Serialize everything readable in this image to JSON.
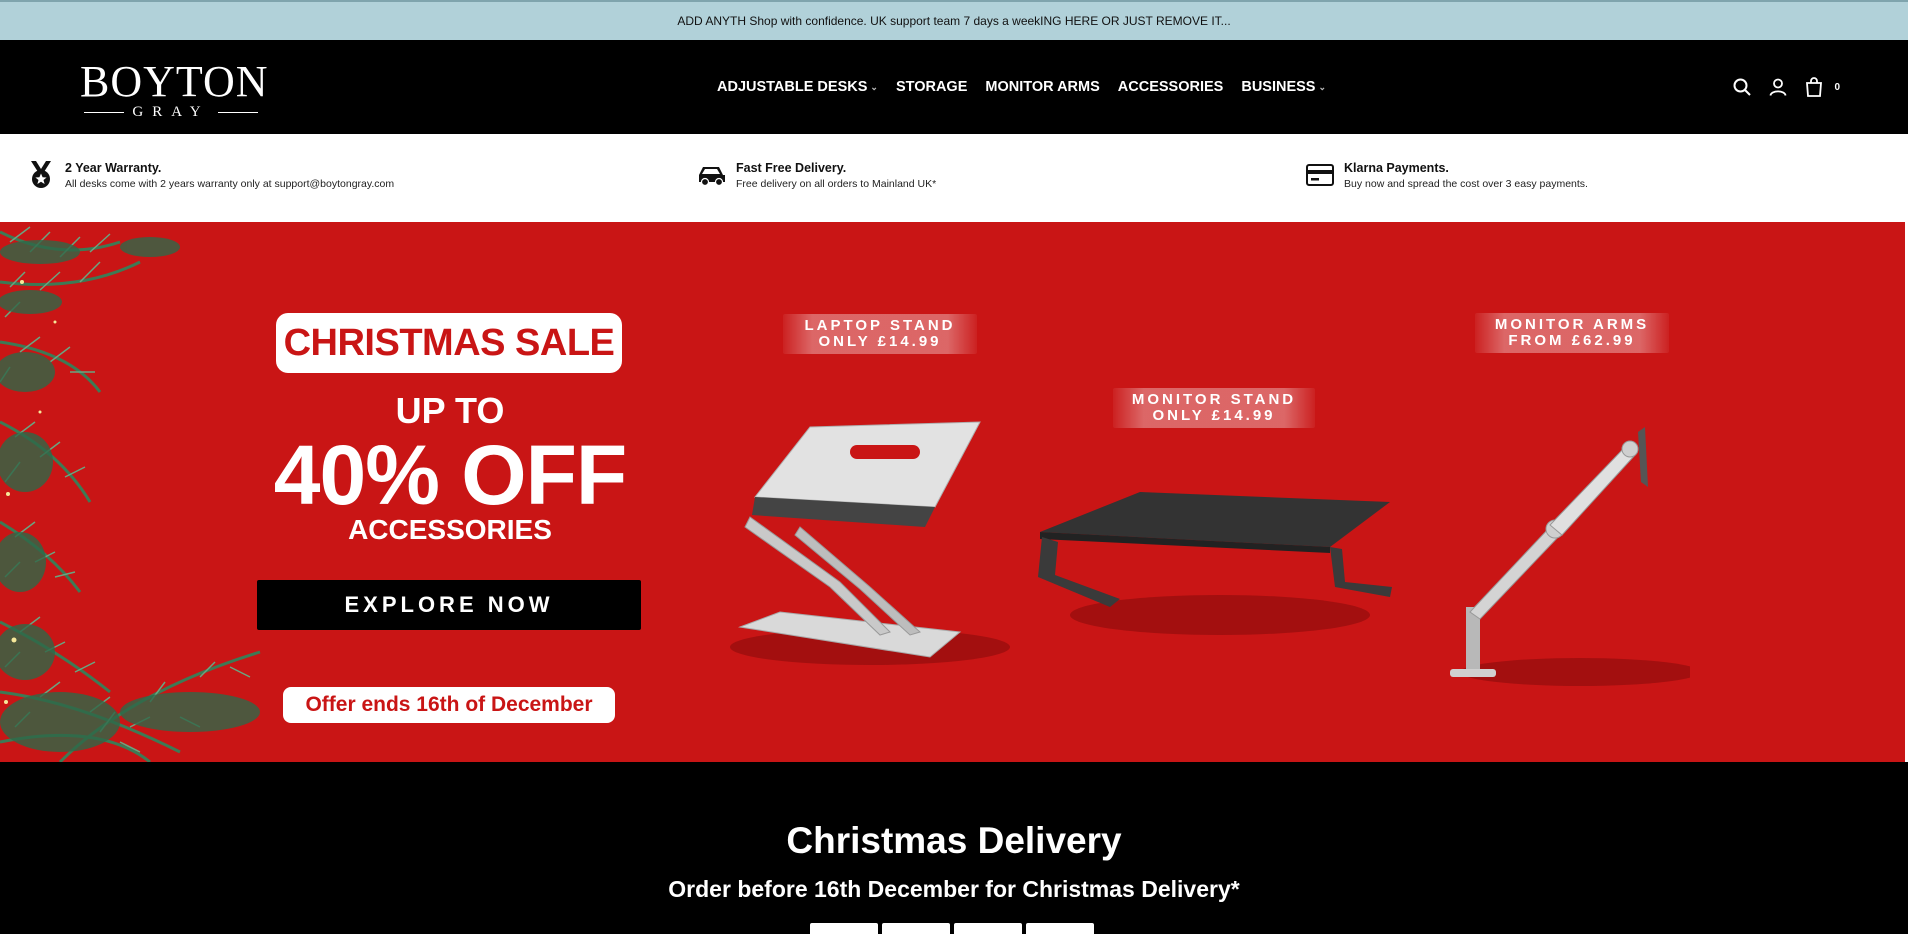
{
  "announcement": "ADD ANYTH Shop with confidence. UK support team 7 days a weekING HERE OR JUST REMOVE IT...",
  "logo": {
    "main": "BOYTON",
    "sub": "GRAY"
  },
  "nav": [
    {
      "label": "ADJUSTABLE DESKS",
      "has_dropdown": true
    },
    {
      "label": "STORAGE",
      "has_dropdown": false
    },
    {
      "label": "MONITOR ARMS",
      "has_dropdown": false
    },
    {
      "label": "ACCESSORIES",
      "has_dropdown": false
    },
    {
      "label": "BUSINESS",
      "has_dropdown": true
    }
  ],
  "header_icons": [
    "search-icon",
    "account-icon",
    "cart-icon"
  ],
  "cart_count": "0",
  "usps": [
    {
      "icon": "medal-icon",
      "title": "2 Year Warranty.",
      "desc": "All desks come with 2 years warranty only at support@boytongray.com"
    },
    {
      "icon": "car-icon",
      "title": "Fast Free Delivery.",
      "desc": "Free delivery on all orders to Mainland UK*"
    },
    {
      "icon": "credit-card-icon",
      "title": "Klarna Payments.",
      "desc": "Buy now and spread the cost over 3 easy payments."
    }
  ],
  "hero": {
    "badge": "CHRISTMAS SALE",
    "upto": "UP TO",
    "percent": "40% OFF",
    "category": "ACCESSORIES",
    "cta": "EXPLORE NOW",
    "offer": "Offer ends 16th of December",
    "tags": [
      {
        "line1": "LAPTOP STAND",
        "line2": "ONLY £14.99"
      },
      {
        "line1": "MONITOR STAND",
        "line2": "ONLY £14.99"
      },
      {
        "line1": "MONITOR ARMS",
        "line2": "FROM £62.99"
      }
    ]
  },
  "delivery": {
    "title": "Christmas Delivery",
    "subtitle": "Order before 16th December for Christmas Delivery*"
  },
  "colors": {
    "hero_red": "#c91515",
    "announce_bg": "#b1d1d9",
    "header_bg": "#000000"
  }
}
